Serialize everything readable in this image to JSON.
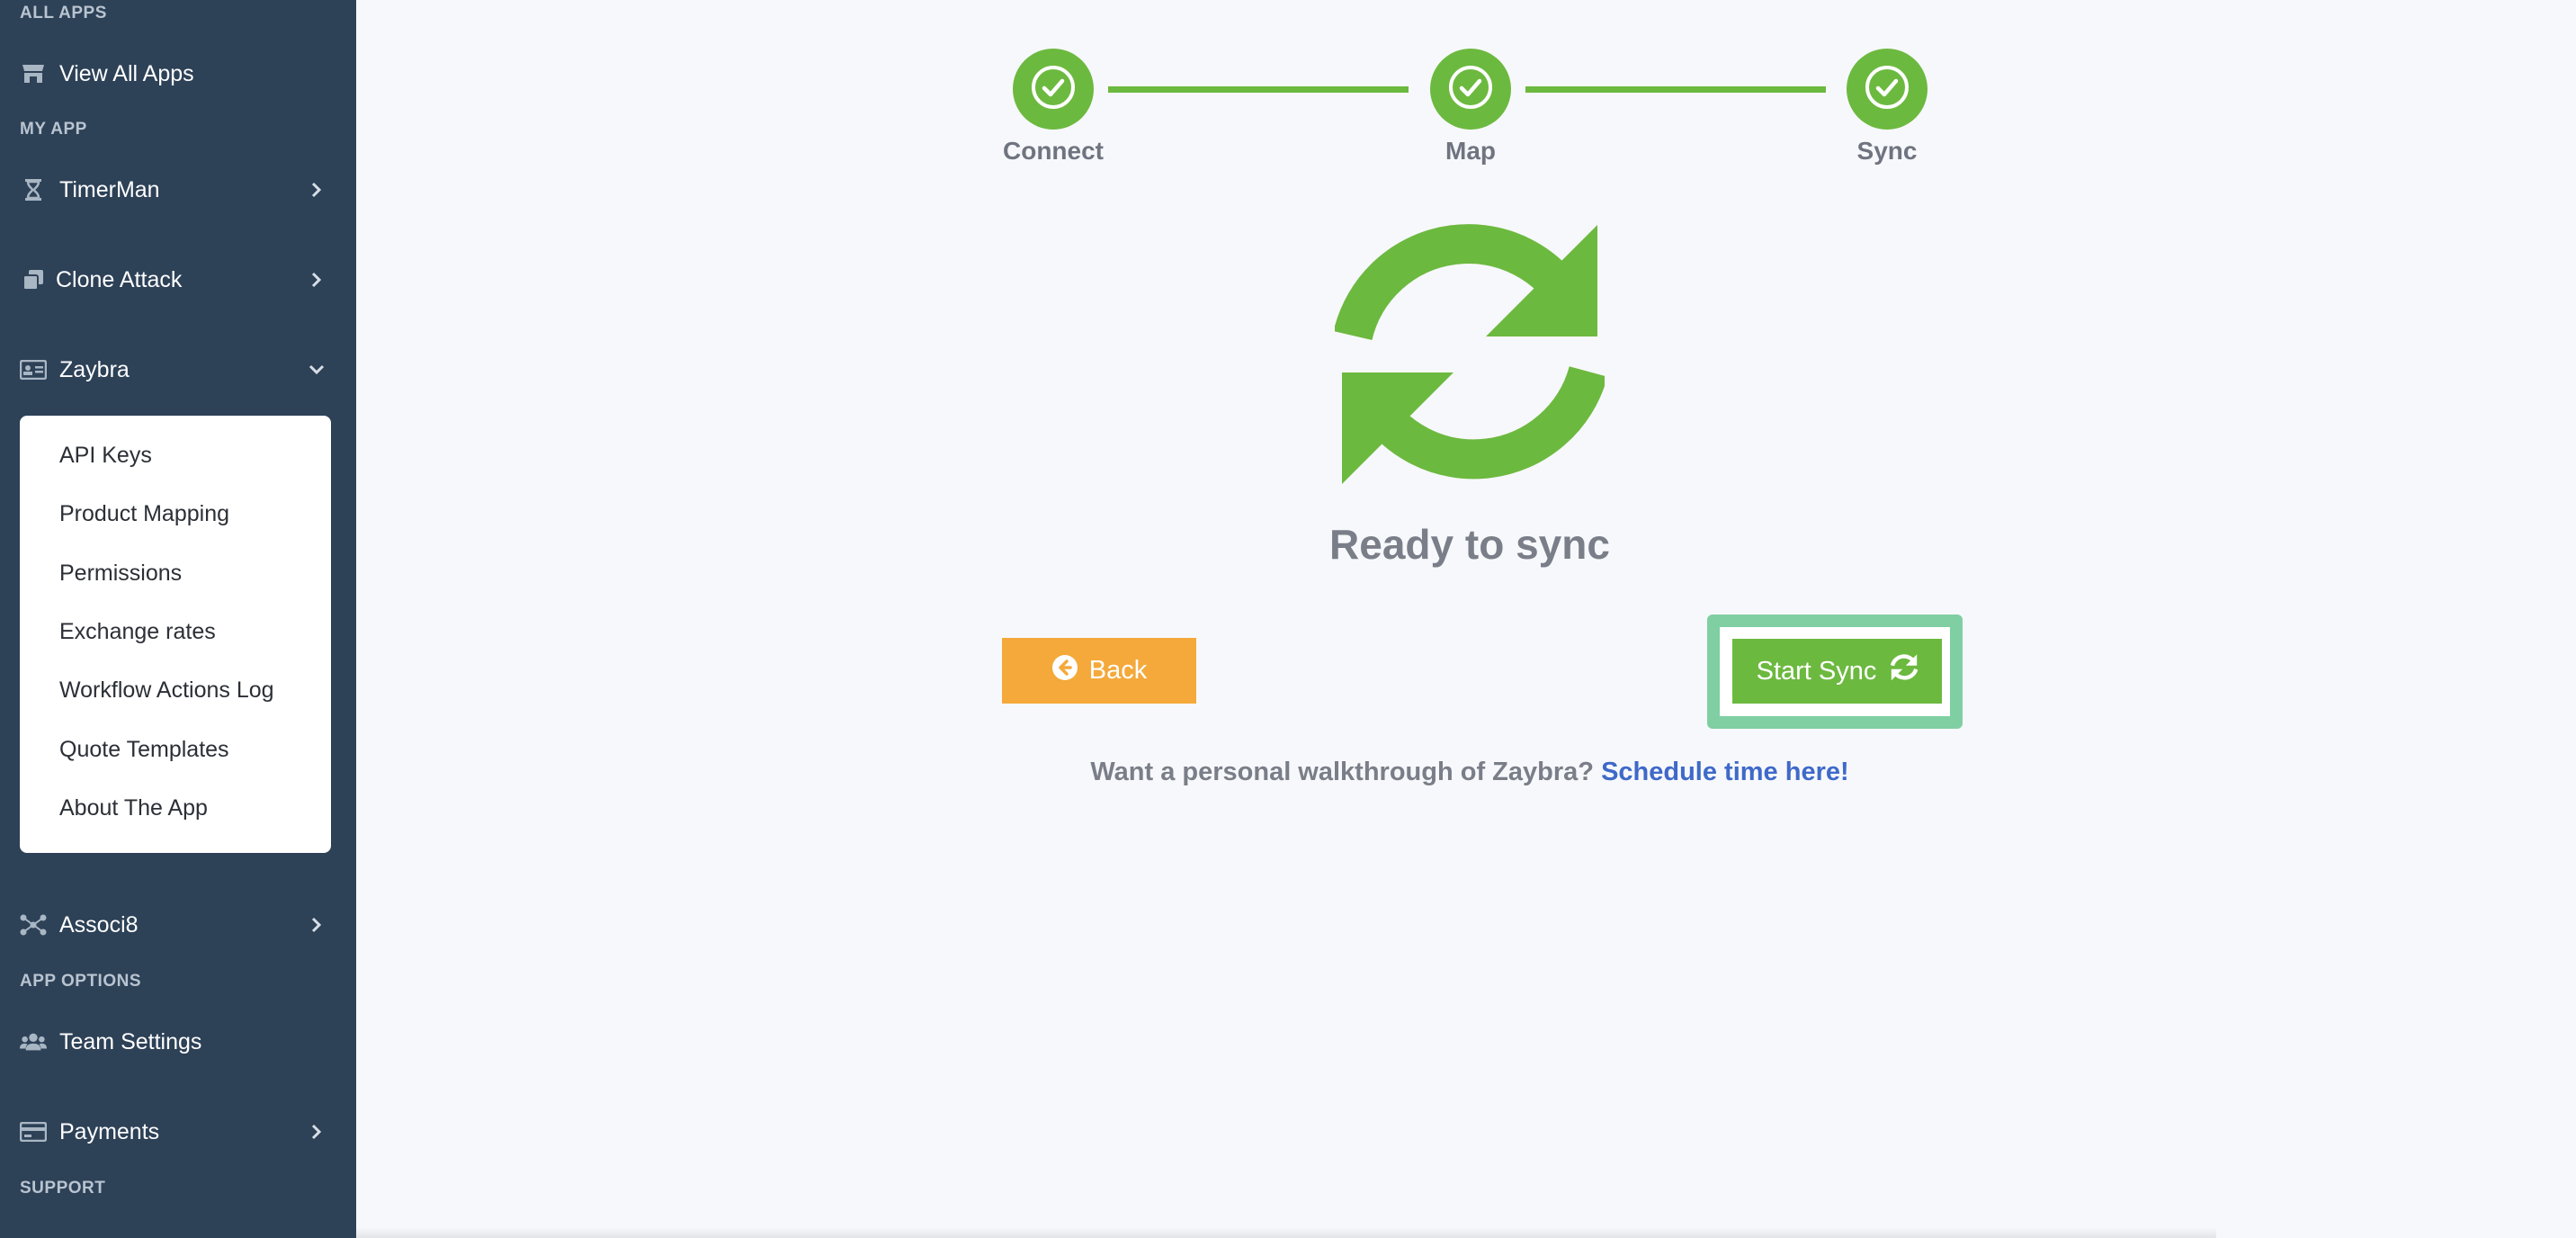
{
  "sidebar": {
    "sections": {
      "all_apps": "ALL APPS",
      "my_app": "MY APP",
      "app_options": "APP OPTIONS",
      "support": "SUPPORT"
    },
    "items": {
      "view_all_apps": "View All Apps",
      "timerman": "TimerMan",
      "clone_attack": "Clone Attack",
      "zaybra": "Zaybra",
      "associ8": "Associ8",
      "team_settings": "Team Settings",
      "payments": "Payments"
    },
    "zaybra_submenu": [
      "API Keys",
      "Product Mapping",
      "Permissions",
      "Exchange rates",
      "Workflow Actions Log",
      "Quote Templates",
      "About The App"
    ]
  },
  "stepper": {
    "steps": [
      "Connect",
      "Map",
      "Sync"
    ],
    "completed": 3
  },
  "main": {
    "title": "Ready to sync",
    "back_label": "Back",
    "start_sync_label": "Start Sync",
    "walkthrough_text": "Want a personal walkthrough of Zaybra?",
    "walkthrough_link": "Schedule time here!"
  },
  "colors": {
    "sidebar_bg": "#2d4157",
    "accent_green": "#6cb93f",
    "back_orange": "#f4a93a",
    "highlight": "#7fcfa3",
    "link_blue": "#3f69c9"
  },
  "icons": {
    "view_all_apps": "store-icon",
    "timerman": "hourglass-icon",
    "clone_attack": "copy-icon",
    "zaybra": "id-card-icon",
    "associ8": "network-icon",
    "team_settings": "users-icon",
    "payments": "credit-card-icon",
    "sync": "sync-icon",
    "back": "arrow-circle-left-icon",
    "check": "check-circle-icon"
  }
}
